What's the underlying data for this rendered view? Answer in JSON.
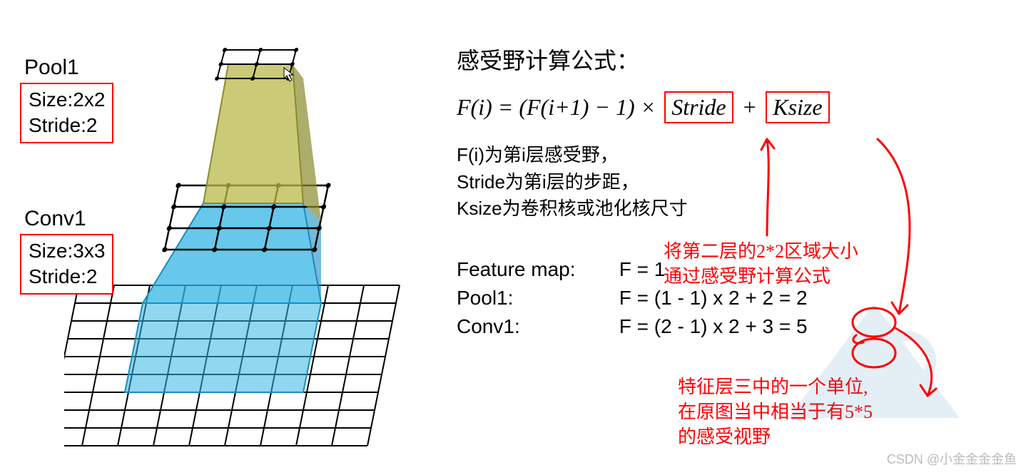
{
  "left": {
    "pool1": {
      "title": "Pool1",
      "size": "Size:2x2",
      "stride": "Stride:2"
    },
    "conv1": {
      "title": "Conv1",
      "size": "Size:3x3",
      "stride": "Stride:2"
    }
  },
  "right": {
    "title": "感受野计算公式：",
    "formula": {
      "lhs": "F(i) = (F(i+1) − 1)",
      "times": "×",
      "stride": "Stride",
      "plus": "+",
      "ksize": "Ksize"
    },
    "desc": {
      "l1": "F(i)为第i层感受野，",
      "l2": "Stride为第i层的步距，",
      "l3": "Ksize为卷积核或池化核尺寸"
    },
    "example": {
      "fm_label": "Feature map:",
      "fm_val": "F = 1",
      "pool1_label": "Pool1:",
      "pool1_val": "F = (1 - 1) x 2 + 2 = 2",
      "conv1_label": "Conv1:",
      "conv1_val": "F = (2 - 1) x 2 + 3 = 5"
    },
    "annotations": {
      "a1_l1": "将第二层的2*2区域大小",
      "a1_l2": "通过感受野计算公式",
      "a2_l1": "特征层三中的一个单位,",
      "a2_l2": "在原图当中相当于有5*5",
      "a2_l3": "的感受视野"
    },
    "watermark": "CSDN @小金金金金鱼"
  },
  "colors": {
    "red": "#ff0000",
    "olive_top": "#b8b84a",
    "olive_dark": "#8a8a2e",
    "blue_light": "#34b6e4",
    "blue_dark": "#1a8bbf"
  }
}
